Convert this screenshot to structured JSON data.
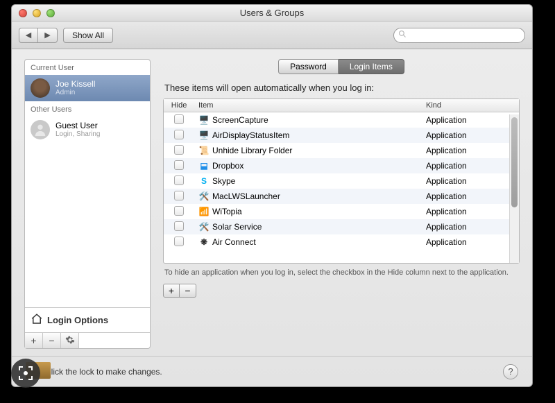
{
  "window": {
    "title": "Users & Groups"
  },
  "toolbar": {
    "show_all": "Show All",
    "search_placeholder": ""
  },
  "sidebar": {
    "current_header": "Current User",
    "current_user": {
      "name": "Joe Kissell",
      "role": "Admin"
    },
    "other_header": "Other Users",
    "other_users": [
      {
        "name": "Guest User",
        "role": "Login, Sharing"
      }
    ],
    "login_options": "Login Options"
  },
  "tabs": {
    "password": "Password",
    "login_items": "Login Items",
    "active": "login_items"
  },
  "main": {
    "instruction": "These items will open automatically when you log in:",
    "columns": {
      "hide": "Hide",
      "item": "Item",
      "kind": "Kind"
    },
    "items": [
      {
        "name": "ScreenCapture",
        "kind": "Application",
        "icon": "display-icon",
        "glyph": "🖥️",
        "color": "#4a78c9"
      },
      {
        "name": "AirDisplayStatusItem",
        "kind": "Application",
        "icon": "display-icon",
        "glyph": "🖥️",
        "color": "#4a78c9"
      },
      {
        "name": "Unhide Library Folder",
        "kind": "Application",
        "icon": "script-icon",
        "glyph": "📜",
        "color": "#b8b8b8"
      },
      {
        "name": "Dropbox",
        "kind": "Application",
        "icon": "dropbox-icon",
        "glyph": "⬓",
        "color": "#1f8ee8"
      },
      {
        "name": "Skype",
        "kind": "Application",
        "icon": "skype-icon",
        "glyph": "S",
        "color": "#00aff0"
      },
      {
        "name": "MacLWSLauncher",
        "kind": "Application",
        "icon": "launcher-icon",
        "glyph": "🛠️",
        "color": "#c8a46b"
      },
      {
        "name": "WiTopia",
        "kind": "Application",
        "icon": "wifi-icon",
        "glyph": "📶",
        "color": "#7a9dc6"
      },
      {
        "name": "Solar Service",
        "kind": "Application",
        "icon": "service-icon",
        "glyph": "🛠️",
        "color": "#c8a46b"
      },
      {
        "name": "Air Connect",
        "kind": "Application",
        "icon": "fan-icon",
        "glyph": "❋",
        "color": "#2b2b2b"
      }
    ],
    "hint": "To hide an application when you log in, select the checkbox in the Hide column next to the application."
  },
  "footer": {
    "lock_text": "Click the lock to make changes."
  }
}
